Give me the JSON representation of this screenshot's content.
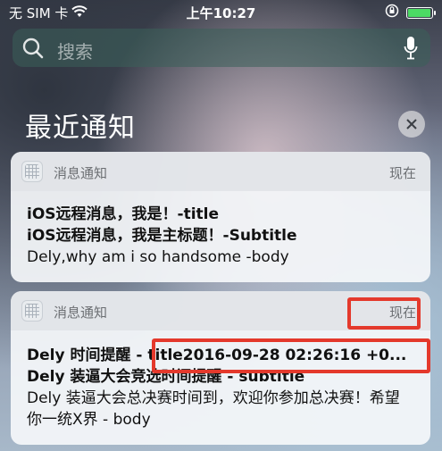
{
  "status": {
    "carrier": "无 SIM 卡",
    "time": "上午10:27"
  },
  "search": {
    "placeholder": "搜索"
  },
  "section": {
    "title": "最近通知"
  },
  "notifications": [
    {
      "app": "消息通知",
      "time": "现在",
      "lines": [
        {
          "text": "iOS远程消息，我是！-title",
          "bold": true
        },
        {
          "text": "iOS远程消息，我是主标题！-Subtitle",
          "bold": true
        },
        {
          "text": "Dely,why am i so handsome -body",
          "bold": false
        }
      ]
    },
    {
      "app": "消息通知",
      "time": "现在",
      "lines": [
        {
          "text": "Dely 时间提醒 - title2016-09-28 02:26:16 +0...",
          "bold": true
        },
        {
          "text": "Dely 装逼大会竞选时间提醒 - subtitle",
          "bold": true
        },
        {
          "text": "Dely 装逼大会总决赛时间到，欢迎你参加总决赛！希望你一统X界 - body",
          "bold": false
        }
      ]
    }
  ],
  "colors": {
    "highlight": "#e4392c",
    "battery": "#4cd964"
  }
}
